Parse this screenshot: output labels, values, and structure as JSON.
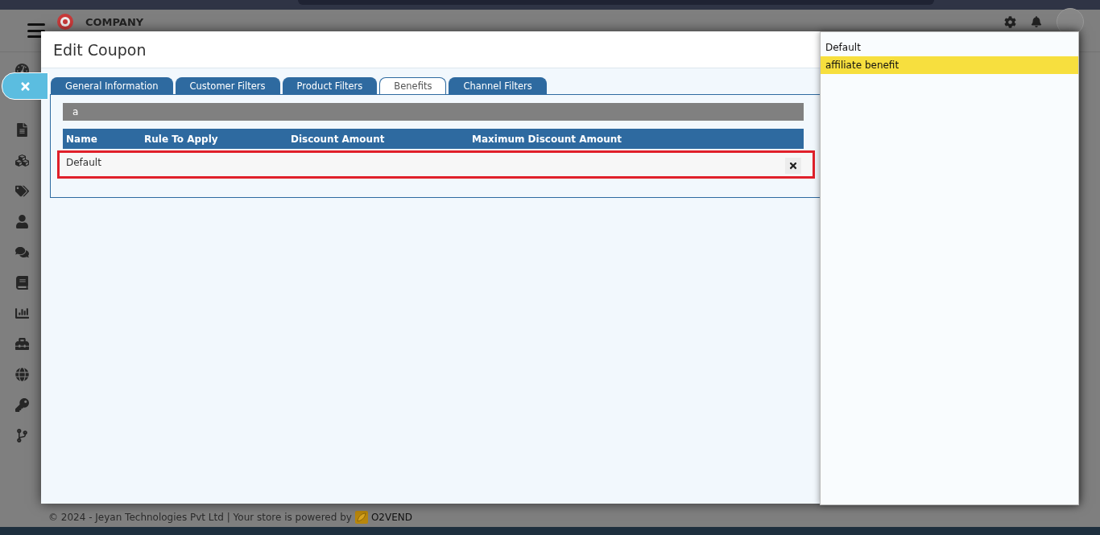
{
  "header": {
    "brand": "COMPANY"
  },
  "dialog": {
    "title": "Edit Coupon",
    "tabs": [
      {
        "label": "General Information",
        "selected": false
      },
      {
        "label": "Customer Filters",
        "selected": false
      },
      {
        "label": "Product Filters",
        "selected": false
      },
      {
        "label": "Benefits",
        "selected": true
      },
      {
        "label": "Channel Filters",
        "selected": false
      }
    ],
    "search": {
      "value": "a"
    },
    "table": {
      "columns": [
        "Name",
        "Rule To Apply",
        "Discount Amount",
        "Maximum Discount Amount"
      ],
      "rows": [
        {
          "name": "Default",
          "highlighted": true
        }
      ]
    }
  },
  "dropdown": {
    "options": [
      {
        "label": "Default",
        "selected": false
      },
      {
        "label": "affiliate benefit",
        "selected": true
      }
    ]
  },
  "footer": {
    "text": "© 2024 - Jeyan Technologies Pvt Ltd | Your store is powered by",
    "brand": "O2VEND"
  }
}
